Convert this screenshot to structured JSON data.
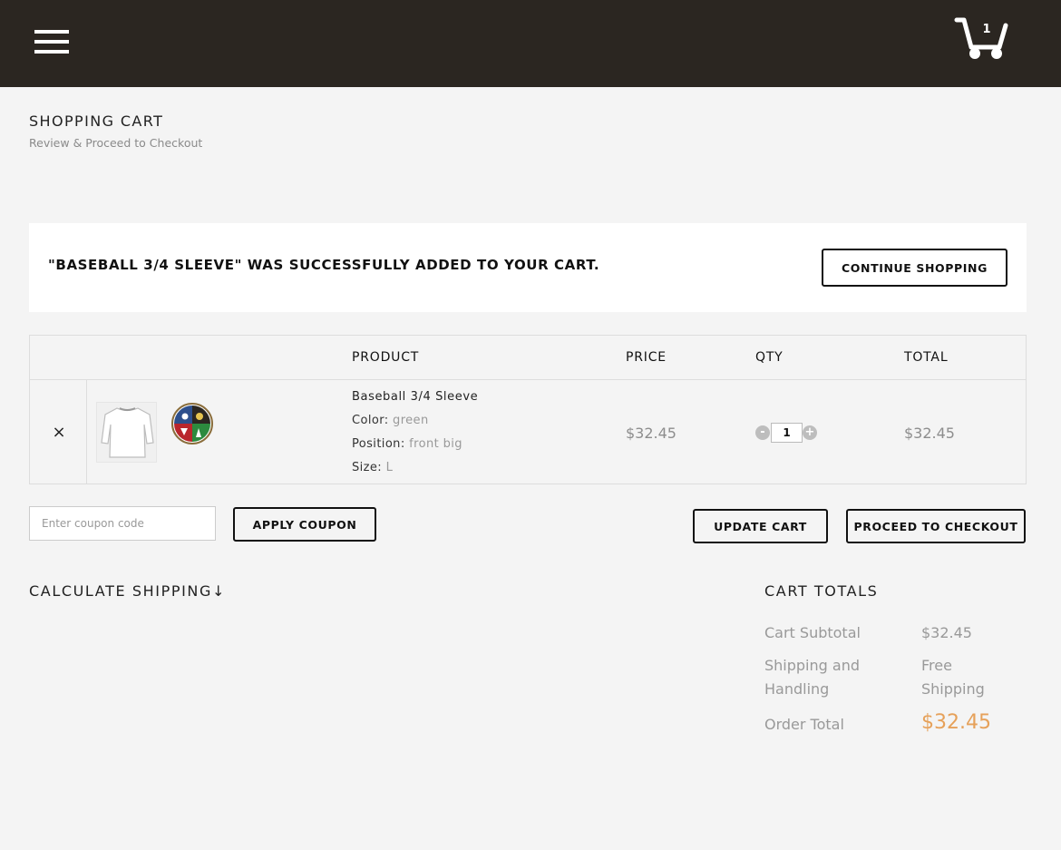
{
  "header": {
    "menu_icon": "hamburger-menu-icon",
    "cart_icon": "shopping-cart-icon",
    "cart_count": "1"
  },
  "page": {
    "title": "SHOPPING CART",
    "subtitle": "Review & Proceed to Checkout"
  },
  "notice": {
    "message": "\"BASEBALL 3/4 SLEEVE\" WAS SUCCESSFULLY ADDED TO YOUR CART.",
    "continue_label": "CONTINUE SHOPPING"
  },
  "table": {
    "headers": {
      "product": "PRODUCT",
      "price": "PRICE",
      "qty": "QTY",
      "total": "TOTAL"
    },
    "rows": [
      {
        "remove": "×",
        "name": "Baseball 3/4 Sleeve",
        "attributes": [
          {
            "label": "Color:",
            "value": "green"
          },
          {
            "label": "Position:",
            "value": "front big"
          },
          {
            "label": "Size:",
            "value": "L"
          }
        ],
        "price": "$32.45",
        "qty": "1",
        "qty_minus": "-",
        "qty_plus": "+",
        "total": "$32.45"
      }
    ]
  },
  "actions": {
    "coupon_placeholder": "Enter coupon code",
    "apply_coupon": "APPLY COUPON",
    "update_cart": "UPDATE CART",
    "proceed": "PROCEED TO CHECKOUT"
  },
  "shipping": {
    "label": "CALCULATE SHIPPING↓"
  },
  "totals": {
    "title": "CART TOTALS",
    "subtotal_label": "Cart Subtotal",
    "subtotal_value": "$32.45",
    "shipping_label": "Shipping and Handling",
    "shipping_value": "Free Shipping",
    "order_label": "Order Total",
    "order_value": "$32.45"
  },
  "colors": {
    "topbar": "#2b2621",
    "background": "#f4f4f4",
    "accent_total": "#e6a15a"
  }
}
